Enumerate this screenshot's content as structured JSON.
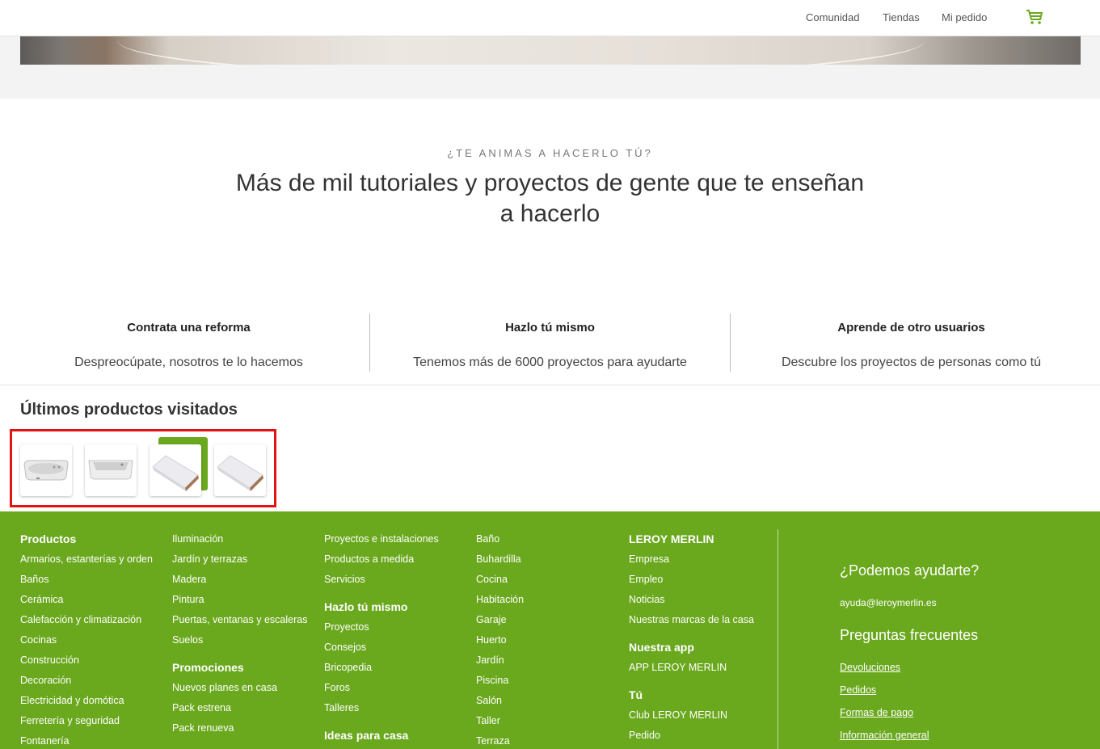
{
  "header": {
    "nav": [
      "Comunidad",
      "Tiendas",
      "Mi pedido"
    ],
    "cart_icon": "cart-icon",
    "accent": "#6aa81e"
  },
  "tutorials": {
    "eyebrow": "¿TE ANIMAS A HACERLO TÚ?",
    "headline": "Más de mil tutoriales y proyectos de gente que te enseñan a hacerlo",
    "columns": [
      {
        "title": "Contrata una reforma",
        "desc": "Despreocúpate, nosotros te lo hacemos"
      },
      {
        "title": "Hazlo tú mismo",
        "desc": "Tenemos más de 6000 proyectos para ayudarte"
      },
      {
        "title": "Aprende de otro usuarios",
        "desc": "Descubre los proyectos de personas como tú"
      }
    ]
  },
  "recent": {
    "title": "Últimos productos visitados",
    "highlight_color": "#e21313"
  },
  "footer": {
    "bg": "#6aa81e",
    "col1": {
      "heading": "Productos",
      "links": [
        "Armarios, estanterías y orden",
        "Baños",
        "Cerámica",
        "Calefacción y climatización",
        "Cocinas",
        "Construcción",
        "Decoración",
        "Electricidad y domótica",
        "Ferretería y seguridad",
        "Fontanería"
      ]
    },
    "col2": {
      "links": [
        "Iluminación",
        "Jardín y terrazas",
        "Madera",
        "Pintura",
        "Puertas, ventanas y escaleras",
        "Suelos"
      ],
      "heading2": "Promociones",
      "links2": [
        "Nuevos planes en casa",
        "Pack estrena",
        "Pack renueva"
      ]
    },
    "col3": {
      "links": [
        "Proyectos e instalaciones",
        "Productos a medida",
        "Servicios"
      ],
      "heading2": "Hazlo tú mismo",
      "links2": [
        "Proyectos",
        "Consejos",
        "Bricopedia",
        "Foros",
        "Talleres"
      ],
      "heading3": "Ideas para casa"
    },
    "col4": {
      "links": [
        "Baño",
        "Buhardilla",
        "Cocina",
        "Habitación",
        "Garaje",
        "Huerto",
        "Jardín",
        "Piscina",
        "Salón",
        "Taller",
        "Terraza"
      ]
    },
    "col5": {
      "heading": "LEROY MERLIN",
      "links": [
        "Empresa",
        "Empleo",
        "Noticias",
        "Nuestras marcas de la casa"
      ],
      "heading2": "Nuestra app",
      "links2": [
        "APP LEROY MERLIN"
      ],
      "heading3": "Tú",
      "links3": [
        "Club LEROY MERLIN",
        "Pedido"
      ]
    },
    "help": {
      "title": "¿Podemos ayudarte?",
      "email": "ayuda@leroymerlin.es",
      "faq_title": "Preguntas frecuentes",
      "faq_links": [
        "Devoluciones",
        "Pedidos",
        "Formas de pago",
        "Información general"
      ]
    }
  }
}
